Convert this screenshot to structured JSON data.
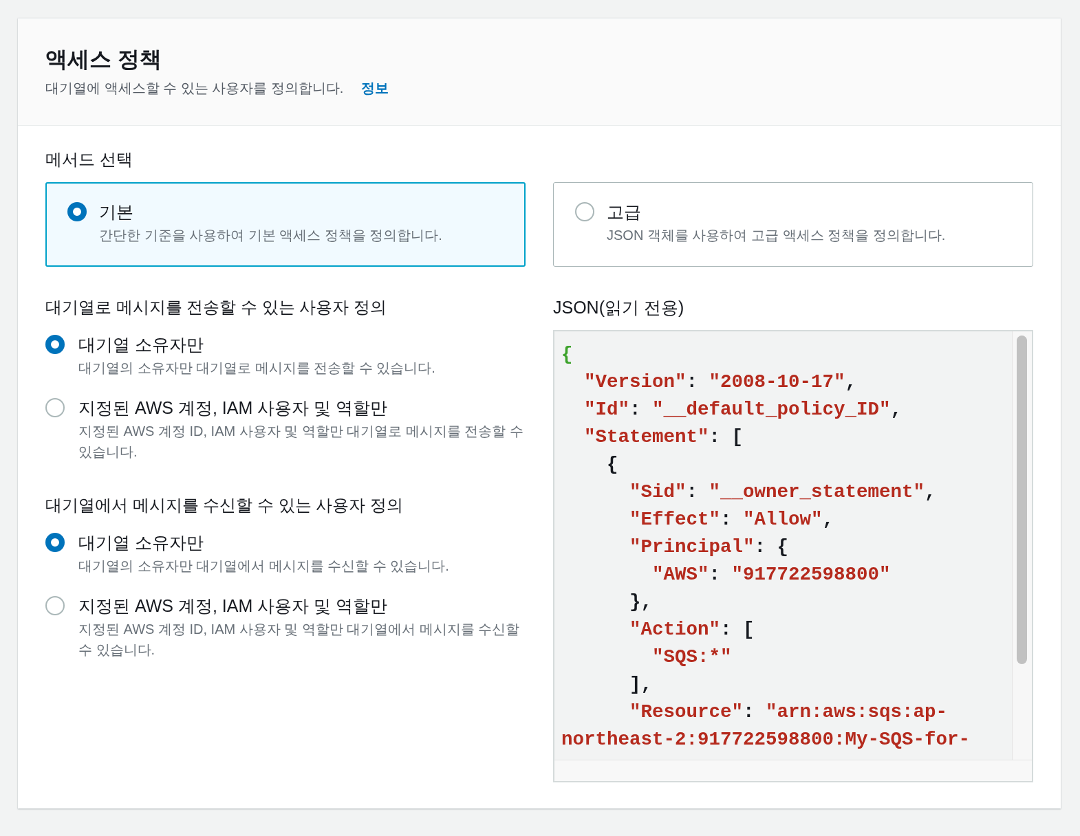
{
  "panel": {
    "title": "액세스 정책",
    "description": "대기열에 액세스할 수 있는 사용자를 정의합니다.",
    "info_link": "정보"
  },
  "method": {
    "label": "메서드 선택",
    "options": [
      {
        "title": "기본",
        "description": "간단한 기준을 사용하여 기본 액세스 정책을 정의합니다.",
        "selected": true
      },
      {
        "title": "고급",
        "description": "JSON 객체를 사용하여 고급 액세스 정책을 정의합니다.",
        "selected": false
      }
    ]
  },
  "send_access": {
    "label": "대기열로 메시지를 전송할 수 있는 사용자 정의",
    "options": [
      {
        "title": "대기열 소유자만",
        "description": "대기열의 소유자만 대기열로 메시지를 전송할 수 있습니다.",
        "selected": true
      },
      {
        "title": "지정된 AWS 계정, IAM 사용자 및 역할만",
        "description": "지정된 AWS 계정 ID, IAM 사용자 및 역할만 대기열로 메시지를 전송할 수 있습니다.",
        "selected": false
      }
    ]
  },
  "receive_access": {
    "label": "대기열에서 메시지를 수신할 수 있는 사용자 정의",
    "options": [
      {
        "title": "대기열 소유자만",
        "description": "대기열의 소유자만 대기열에서 메시지를 수신할 수 있습니다.",
        "selected": true
      },
      {
        "title": "지정된 AWS 계정, IAM 사용자 및 역할만",
        "description": "지정된 AWS 계정 ID, IAM 사용자 및 역할만 대기열에서 메시지를 수신할 수 있습니다.",
        "selected": false
      }
    ]
  },
  "json_view": {
    "label": "JSON(읽기 전용)",
    "lines": [
      [
        {
          "kind": "brace",
          "text": "{"
        }
      ],
      [
        {
          "kind": "key",
          "text": "  \"Version\""
        },
        {
          "kind": "punct",
          "text": ": "
        },
        {
          "kind": "string",
          "text": "\"2008-10-17\""
        },
        {
          "kind": "punct",
          "text": ","
        }
      ],
      [
        {
          "kind": "key",
          "text": "  \"Id\""
        },
        {
          "kind": "punct",
          "text": ": "
        },
        {
          "kind": "string",
          "text": "\"__default_policy_ID\""
        },
        {
          "kind": "punct",
          "text": ","
        }
      ],
      [
        {
          "kind": "key",
          "text": "  \"Statement\""
        },
        {
          "kind": "punct",
          "text": ": ["
        }
      ],
      [
        {
          "kind": "punct",
          "text": "    {"
        }
      ],
      [
        {
          "kind": "key",
          "text": "      \"Sid\""
        },
        {
          "kind": "punct",
          "text": ": "
        },
        {
          "kind": "string",
          "text": "\"__owner_statement\""
        },
        {
          "kind": "punct",
          "text": ","
        }
      ],
      [
        {
          "kind": "key",
          "text": "      \"Effect\""
        },
        {
          "kind": "punct",
          "text": ": "
        },
        {
          "kind": "string",
          "text": "\"Allow\""
        },
        {
          "kind": "punct",
          "text": ","
        }
      ],
      [
        {
          "kind": "key",
          "text": "      \"Principal\""
        },
        {
          "kind": "punct",
          "text": ": {"
        }
      ],
      [
        {
          "kind": "key",
          "text": "        \"AWS\""
        },
        {
          "kind": "punct",
          "text": ": "
        },
        {
          "kind": "string",
          "text": "\"917722598800\""
        }
      ],
      [
        {
          "kind": "punct",
          "text": "      },"
        }
      ],
      [
        {
          "kind": "key",
          "text": "      \"Action\""
        },
        {
          "kind": "punct",
          "text": ": ["
        }
      ],
      [
        {
          "kind": "string",
          "text": "        \"SQS:*\""
        }
      ],
      [
        {
          "kind": "punct",
          "text": "      ],"
        }
      ],
      [
        {
          "kind": "key",
          "text": "      \"Resource\""
        },
        {
          "kind": "punct",
          "text": ": "
        },
        {
          "kind": "string",
          "text": "\"arn:aws:sqs:ap-"
        }
      ],
      [
        {
          "kind": "string",
          "text": "northeast-2:917722598800:My-SQS-for-"
        }
      ]
    ]
  }
}
